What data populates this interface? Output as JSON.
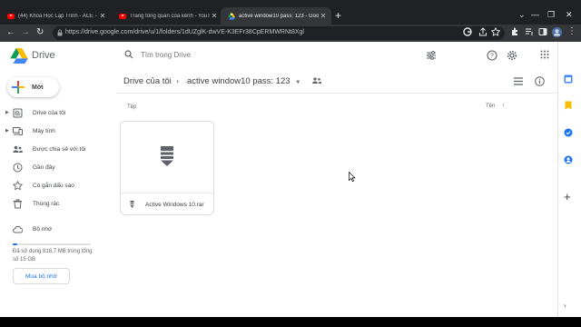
{
  "browser": {
    "tabs": [
      {
        "title": "(44) Khóa Học Lập Trình - ACE - Y",
        "favicon": "youtube-icon",
        "active": false
      },
      {
        "title": "Trang tổng quan của kênh - YouT",
        "favicon": "youtube-icon",
        "active": false
      },
      {
        "title": "active window10 pass: 123 - Goo",
        "favicon": "drive-icon",
        "active": true
      }
    ],
    "url": "https://drive.google.com/drive/u/1/folders/1dUZglK-dwVE-K3EFr38CpERMWRNt8Xgl"
  },
  "header": {
    "brand": "Drive",
    "search": {
      "placeholder": "Tìm trong Drive"
    }
  },
  "sidebar": {
    "new_label": "Mới",
    "items": [
      {
        "label": "Drive của tôi",
        "icon": "my-drive-icon",
        "expandable": true
      },
      {
        "label": "Máy tính",
        "icon": "computer-icon",
        "expandable": true
      },
      {
        "label": "Được chia sẻ với tôi",
        "icon": "shared-icon",
        "expandable": false
      },
      {
        "label": "Gần đây",
        "icon": "clock-icon",
        "expandable": false
      },
      {
        "label": "Có gắn dấu sao",
        "icon": "star-icon",
        "expandable": false
      },
      {
        "label": "Thùng rác",
        "icon": "trash-icon",
        "expandable": false
      },
      {
        "label": "Bộ nhớ",
        "icon": "cloud-icon",
        "expandable": false
      }
    ],
    "storage": {
      "text": "Đã sử dụng 818,7 MB trong tổng số 15 GB",
      "used_fraction": 0.053,
      "buy_label": "Mua bộ nhớ"
    }
  },
  "main": {
    "breadcrumb": {
      "root": "Drive của tôi",
      "current": "active window10 pass: 123"
    },
    "files_label": "Tệp",
    "sort_label": "Tên",
    "files": [
      {
        "name": "Active Windows 10.rar",
        "icon": "archive-icon"
      }
    ]
  },
  "colors": {
    "accent": "#1a73e8",
    "chrome_dark": "#202124",
    "chrome_mid": "#35363a"
  }
}
